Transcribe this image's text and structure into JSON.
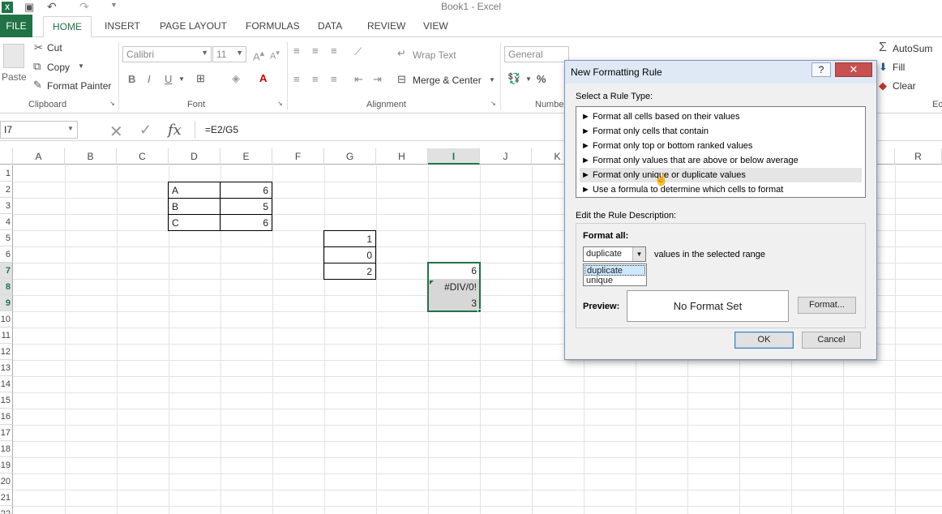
{
  "window": {
    "title": "Book1 - Excel"
  },
  "tabs": [
    "FILE",
    "HOME",
    "INSERT",
    "PAGE LAYOUT",
    "FORMULAS",
    "DATA",
    "REVIEW",
    "VIEW"
  ],
  "ribbon": {
    "clipboard": {
      "paste": "Paste",
      "cut": "Cut",
      "copy": "Copy",
      "format_painter": "Format Painter",
      "label": "Clipboard"
    },
    "font": {
      "name": "Calibri",
      "size": "11",
      "label": "Font",
      "bold": "B",
      "italic": "I",
      "underline": "U"
    },
    "alignment": {
      "wrap_text": "Wrap Text",
      "merge_center": "Merge & Center",
      "label": "Alignment"
    },
    "number": {
      "format": "General",
      "label": "Numbe",
      "percent": "%"
    },
    "editing": {
      "autosum": "AutoSum",
      "fill": "Fill",
      "clear": "Clear",
      "label_partial": "Ec"
    }
  },
  "formula_bar": {
    "name_box": "I7",
    "formula": "=E2/G5"
  },
  "grid": {
    "columns": [
      "A",
      "B",
      "C",
      "D",
      "E",
      "F",
      "G",
      "H",
      "I",
      "J",
      "K",
      "R"
    ],
    "rows": [
      "1",
      "2",
      "3",
      "4",
      "5",
      "6",
      "7",
      "8",
      "9",
      "10",
      "11",
      "12",
      "13",
      "14",
      "15",
      "16",
      "17",
      "18",
      "19",
      "20",
      "21",
      "22"
    ],
    "table1": [
      [
        "A",
        "6"
      ],
      [
        "B",
        "5"
      ],
      [
        "C",
        "6"
      ]
    ],
    "table2": [
      "1",
      "0",
      "2"
    ],
    "table3": [
      "6",
      "#DIV/0!",
      "3"
    ]
  },
  "dialog": {
    "title": "New Formatting Rule",
    "help": "?",
    "close": "✕",
    "select_rule_label": "Select a Rule Type:",
    "rules": [
      "► Format all cells based on their values",
      "► Format only cells that contain",
      "► Format only top or bottom ranked values",
      "► Format only values that are above or below average",
      "► Format only unique or duplicate values",
      "► Use a formula to determine which cells to format"
    ],
    "edit_label": "Edit the Rule Description:",
    "format_all_label": "Format all:",
    "dropdown_value": "duplicate",
    "dropdown_options": [
      "duplicate",
      "unique"
    ],
    "values_text": "values in the selected range",
    "preview_label": "Preview:",
    "preview_text": "No Format Set",
    "format_button": "Format...",
    "ok": "OK",
    "cancel": "Cancel"
  }
}
